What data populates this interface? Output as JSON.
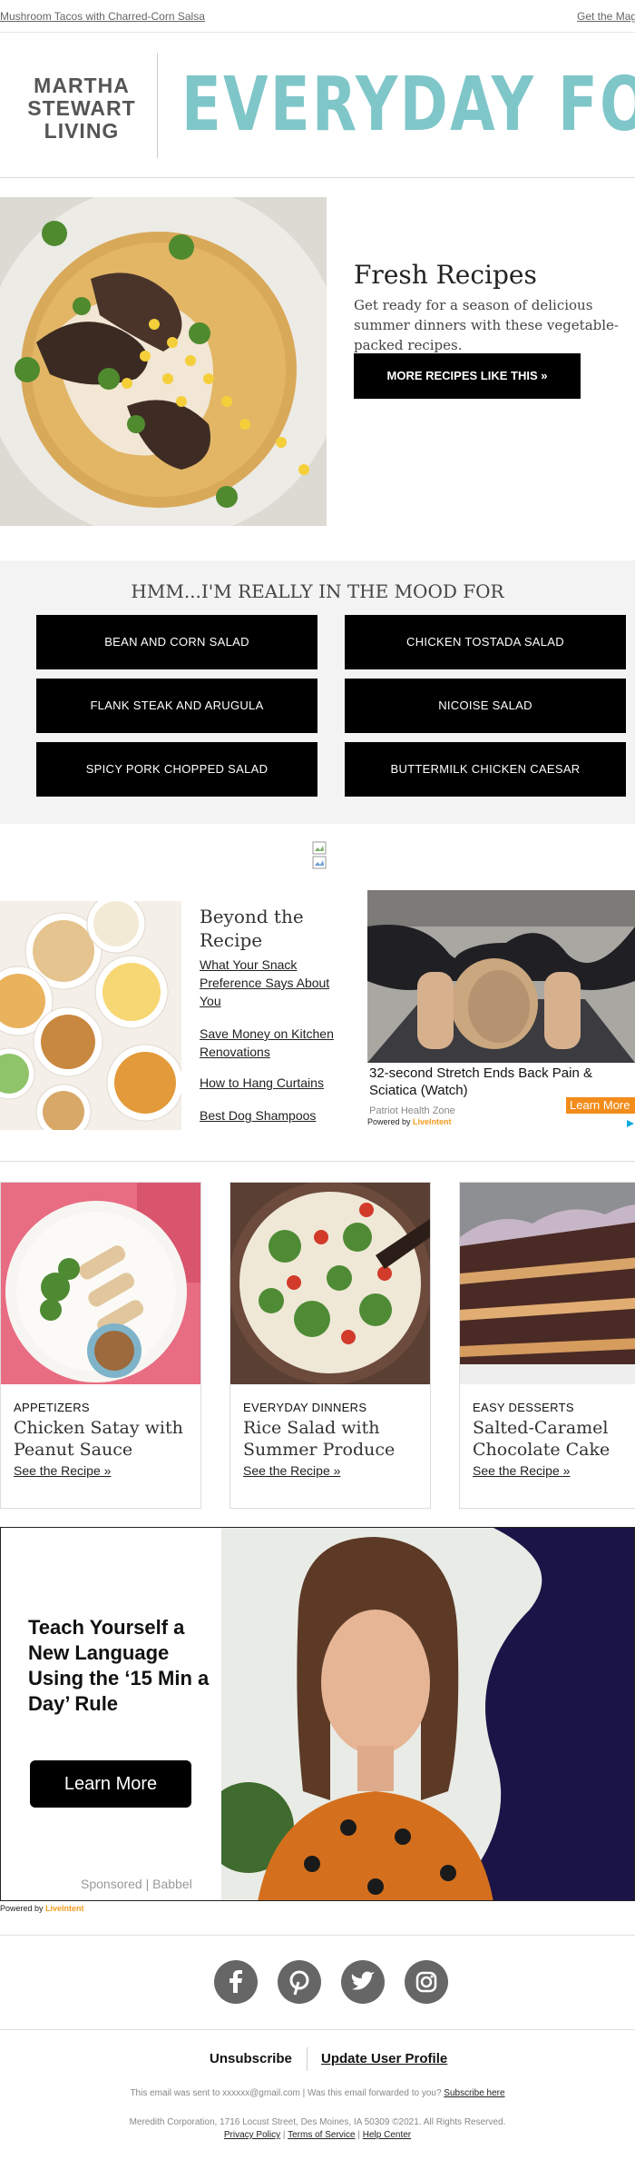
{
  "topbar": {
    "left_link": "Mushroom Tacos with Charred-Corn Salsa",
    "right_link": "Get the Mag"
  },
  "masthead": {
    "brand_line1": "MARTHA",
    "brand_line2": "STEWART",
    "brand_line3": "LIVING",
    "logo_text": "EVERYDAY FOOD",
    "logo_color": "#7fc6c9"
  },
  "hero": {
    "image_icon": "mushroom-taco-photo",
    "title": "Fresh Recipes",
    "description": "Get ready for a season of delicious summer dinners with these vegetable-packed recipes.",
    "button_label": "MORE RECIPES LIKE THIS »"
  },
  "mood": {
    "title": "HMM...I'M REALLY IN THE MOOD FOR",
    "buttons": [
      "BEAN AND CORN SALAD",
      "CHICKEN TOSTADA SALAD",
      "FLANK STEAK AND ARUGULA",
      "NICOISE SALAD",
      "SPICY PORK CHOPPED SALAD",
      "BUTTERMILK CHICKEN CAESAR"
    ]
  },
  "broken_image_icon": "broken-image-icon",
  "beyond": {
    "image_icon": "snack-bowls-photo",
    "title": "Beyond the Recipe",
    "links": [
      "What Your Snack Preference Says About You",
      "Save Money on Kitchen Renovations",
      "How to Hang Curtains",
      "Best Dog Shampoos"
    ]
  },
  "ad1": {
    "image_icon": "stretch-pose-photo",
    "title": "32-second Stretch Ends Back Pain & Sciatica (Watch)",
    "source": "Patriot Health Zone",
    "button_label": "Learn More",
    "powered_prefix": "Powered by",
    "powered_brand": "LiveIntent",
    "accent_color": "#f28c1a"
  },
  "cards": [
    {
      "category": "APPETIZERS",
      "title": "Chicken Satay with Peanut Sauce",
      "link": "See the Recipe »",
      "image_icon": "chicken-satay-photo"
    },
    {
      "category": "EVERYDAY DINNERS",
      "title": "Rice Salad with Summer Produce",
      "link": "See the Recipe »",
      "image_icon": "rice-salad-photo"
    },
    {
      "category": "EASY DESSERTS",
      "title": "Salted-Caramel Chocolate Cake",
      "link": "See the Recipe »",
      "image_icon": "chocolate-cake-photo"
    }
  ],
  "ad2": {
    "headline": "Teach Yourself a New Language Using the ‘15 Min a Day’ Rule",
    "button_label": "Learn More",
    "sponsor": "Sponsored | Babbel",
    "image_icon": "woman-portrait-photo",
    "powered_prefix": "Powered by",
    "powered_brand": "LiveIntent"
  },
  "social": [
    "facebook-icon",
    "pinterest-icon",
    "twitter-icon",
    "instagram-icon"
  ],
  "footer": {
    "unsubscribe": "Unsubscribe",
    "update_profile": "Update User Profile",
    "sent_to": "This email was sent to xxxxxx@gmail.com  |  Was this email forwarded to you?",
    "subscribe": "Subscribe here",
    "address": "Meredith Corporation, 1716 Locust Street, Des Moines, IA 50309 ©2021. All Rights Reserved.",
    "privacy": "Privacy Policy",
    "terms": "Terms of Service",
    "help": "Help Center",
    "sep": "|"
  }
}
